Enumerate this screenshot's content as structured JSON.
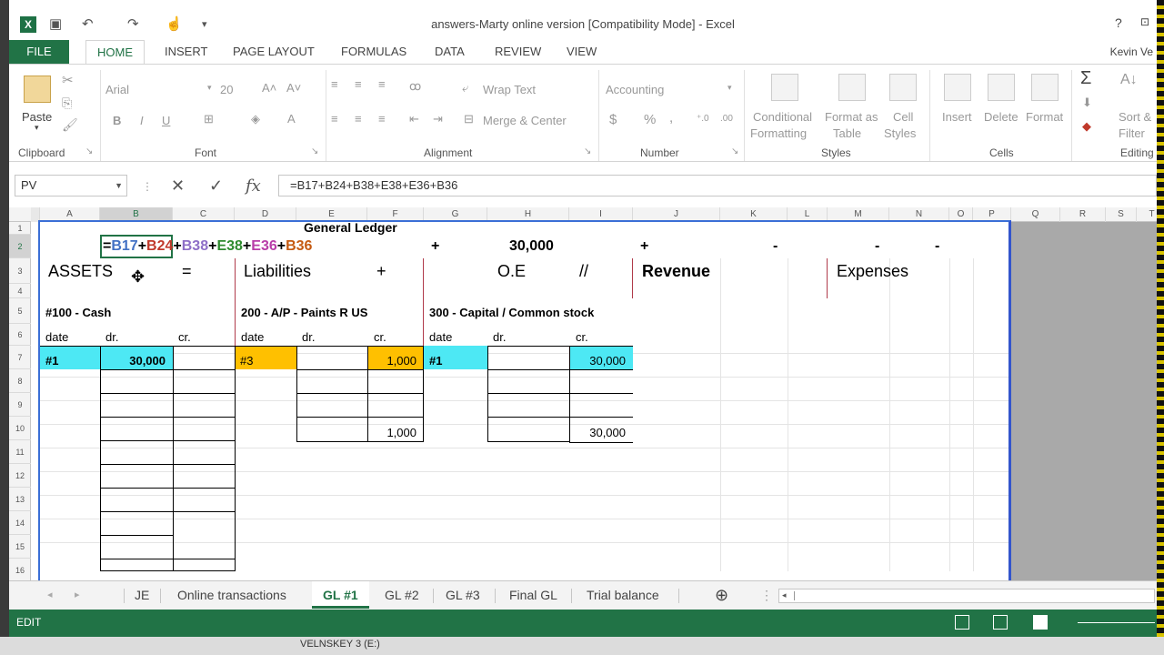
{
  "window": {
    "title": "answers-Marty online version  [Compatibility Mode] - Excel",
    "help": "?",
    "user": "Kevin Ve"
  },
  "ribbon_tabs": [
    "FILE",
    "HOME",
    "INSERT",
    "PAGE LAYOUT",
    "FORMULAS",
    "DATA",
    "REVIEW",
    "VIEW"
  ],
  "ribbon": {
    "paste": "Paste",
    "font_name": "Arial",
    "font_size": "20",
    "bold": "B",
    "italic": "I",
    "underline": "U",
    "wrap_text": "Wrap Text",
    "merge_center": "Merge & Center",
    "number_format": "Accounting",
    "currency": "$",
    "percent": "%",
    "comma": ",",
    "cond_fmt_1": "Conditional",
    "cond_fmt_2": "Formatting",
    "fmt_table_1": "Format as",
    "fmt_table_2": "Table",
    "cell_styles_1": "Cell",
    "cell_styles_2": "Styles",
    "insert": "Insert",
    "delete": "Delete",
    "format": "Format",
    "sum": "Σ",
    "sort_1": "Sort &",
    "sort_2": "Filter",
    "groups": {
      "clipboard": "Clipboard",
      "font": "Font",
      "alignment": "Alignment",
      "number": "Number",
      "styles": "Styles",
      "cells": "Cells",
      "editing": "Editing"
    }
  },
  "formula_bar": {
    "name_box": "PV",
    "cancel": "✕",
    "enter": "✓",
    "fx": "fx",
    "formula": "=B17+B24+B38+E38+E36+B36"
  },
  "columns": [
    "A",
    "B",
    "C",
    "D",
    "E",
    "F",
    "G",
    "H",
    "I",
    "J",
    "K",
    "L",
    "M",
    "N",
    "O",
    "P",
    "Q",
    "R",
    "S",
    "T"
  ],
  "rows": [
    "1",
    "2",
    "3",
    "4",
    "5",
    "6",
    "7",
    "8",
    "9",
    "10",
    "11",
    "12",
    "13",
    "14",
    "15",
    "16"
  ],
  "sheet": {
    "heading": "General Ledger",
    "r2": {
      "eq": "=",
      "b17": "B17",
      "p1": "+",
      "b24": "B24",
      "p2": "+",
      "b38": "B38",
      "p3": "+",
      "e38": "E38",
      "p4": "+",
      "e36": "E36",
      "p5": "+",
      "b36": "B36",
      "g_plus": "+",
      "h_value": "30,000",
      "j_plus": "+",
      "k_dash": "-",
      "m_dash": "-",
      "n_dash": "-"
    },
    "r3": {
      "assets": "ASSETS",
      "equals": "=",
      "liabilities": "Liabilities",
      "plus": "+",
      "oe": "O.E",
      "slashes": "//",
      "revenue": "Revenue",
      "expenses": "Expenses"
    },
    "accounts": {
      "cash": "#100 - Cash",
      "ap": "200 - A/P - Paints R US",
      "capital": "300 - Capital / Common stock"
    },
    "col_labels": {
      "date": "date",
      "dr": "dr.",
      "cr": "cr."
    },
    "r7": {
      "cash_date": "#1",
      "cash_dr": "30,000",
      "ap_date": "#3",
      "ap_cr": "1,000",
      "cap_date": "#1",
      "cap_cr": "30,000"
    },
    "r10": {
      "ap_total": "1,000",
      "cap_total": "30,000"
    }
  },
  "sheet_tabs": [
    "JE",
    "Online transactions",
    "GL #1",
    "GL #2",
    "GL #3",
    "Final GL",
    "Trial balance"
  ],
  "active_sheet": "GL #1",
  "status": {
    "mode": "EDIT"
  },
  "taskbar": {
    "item": "VELNSKEY 3 (E:)"
  },
  "colors": {
    "excel_green": "#217346",
    "cyan_fill": "#4de8f4",
    "orange_fill": "#ffc000",
    "ref_blue": "#4472c4",
    "ref_red": "#c0392b",
    "ref_purple": "#8e6fc7",
    "ref_green": "#2e8b2e",
    "ref_magenta": "#b83ea8",
    "ref_orange": "#c55a11"
  }
}
